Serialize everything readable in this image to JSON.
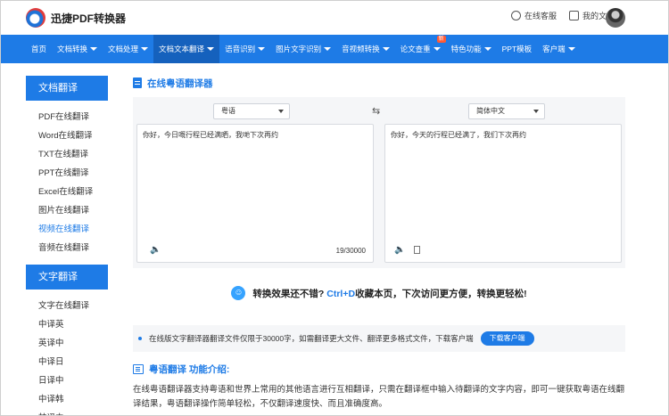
{
  "header": {
    "logo_text": "迅捷PDF转换器",
    "service_label": "在线客服",
    "my_files_label": "我的文件"
  },
  "nav": {
    "items": [
      {
        "label": "首页",
        "caret": false
      },
      {
        "label": "文档转换",
        "caret": true
      },
      {
        "label": "文档处理",
        "caret": true
      },
      {
        "label": "文档文本翻译",
        "caret": true
      },
      {
        "label": "语音识别",
        "caret": true
      },
      {
        "label": "图片文字识别",
        "caret": true
      },
      {
        "label": "音视频转换",
        "caret": true
      },
      {
        "label": "论文查重",
        "caret": true
      },
      {
        "label": "特色功能",
        "caret": true
      },
      {
        "label": "PPT模板",
        "caret": false
      },
      {
        "label": "客户端",
        "caret": true
      }
    ],
    "active_index": 3,
    "new_badge": "新"
  },
  "sidebar": {
    "doc_head": "文档翻译",
    "doc_items": [
      "PDF在线翻译",
      "Word在线翻译",
      "TXT在线翻译",
      "PPT在线翻译",
      "Excel在线翻译",
      "图片在线翻译",
      "视频在线翻译",
      "音频在线翻译"
    ],
    "doc_active_index": 6,
    "text_head": "文字翻译",
    "text_items": [
      "文字在线翻译",
      "中译英",
      "英译中",
      "中译日",
      "日译中",
      "中译韩",
      "韩译中"
    ]
  },
  "translator": {
    "title": "在线粤语翻译器",
    "source_lang": "粤语",
    "target_lang": "简体中文",
    "source_text": "你好，今日嘅行程已经满晒，我哋下次再约",
    "target_text": "你好，今天的行程已经满了，我们下次再约",
    "char_count": "19/30000"
  },
  "promo": {
    "prefix": "转换效果还不错?",
    "shortcut": "Ctrl+D",
    "suffix": "收藏本页，下次访问更方便，转换更轻松!"
  },
  "notice": {
    "text": "在线版文字翻译器翻译文件仅限于30000字，如需翻译更大文件、翻译更多格式文件，下载客户端",
    "button": "下载客户端"
  },
  "intro": {
    "title": "粤语翻译 功能介绍:",
    "text": "在线粤语翻译器支持粤语和世界上常用的其他语言进行互相翻译，只需在翻译框中输入待翻译的文字内容，即可一键获取粤语在线翻译结果，粤语翻译操作简单轻松，不仅翻译速度快、而且准确度高。"
  },
  "colors": {
    "brand": "#1e7be6",
    "badge": "#ff5a36"
  }
}
